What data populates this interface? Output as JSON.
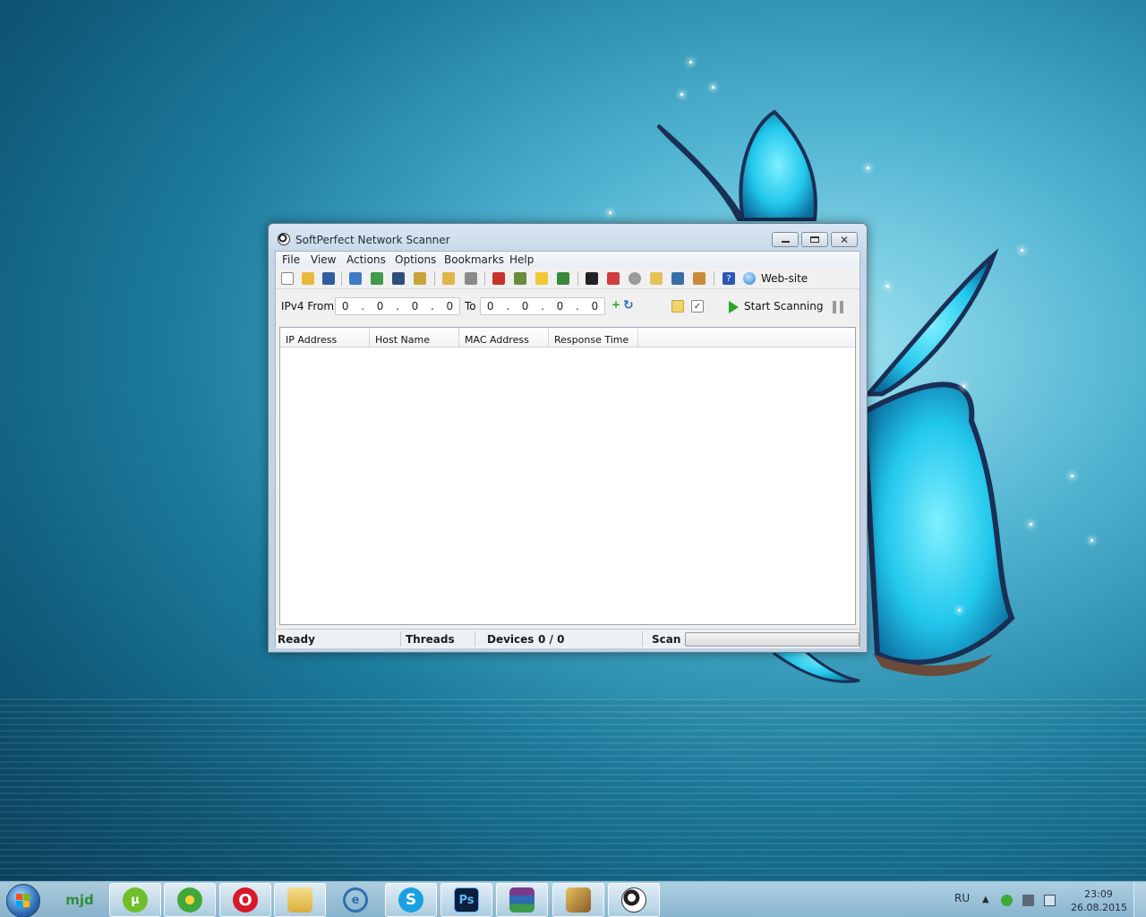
{
  "window": {
    "title": "SoftPerfect Network Scanner",
    "menu": [
      "File",
      "View",
      "Actions",
      "Options",
      "Bookmarks",
      "Help"
    ],
    "toolbar": {
      "website_label": "Web-site"
    },
    "range": {
      "from_label": "IPv4 From",
      "from_value": [
        "0",
        ".",
        "0",
        ".",
        "0",
        ".",
        "0"
      ],
      "to_label": "To",
      "to_value": [
        "0",
        ".",
        "0",
        ".",
        "0",
        ".",
        "0"
      ],
      "start_label": "Start Scanning"
    },
    "columns": [
      "IP Address",
      "Host Name",
      "MAC Address",
      "Response Time"
    ],
    "status": {
      "state": "Ready",
      "threads_label": "Threads",
      "devices_label": "Devices",
      "devices_value": "0 / 0",
      "scan_label": "Scan",
      "scan_progress": 0
    }
  },
  "taskbar": {
    "apps": [
      {
        "name": "mjd",
        "icon": "mjd-icon",
        "active": false
      },
      {
        "name": "uTorrent",
        "icon": "utorrent-icon",
        "active": true
      },
      {
        "name": "ICQ",
        "icon": "icq-icon",
        "active": true
      },
      {
        "name": "Opera",
        "icon": "opera-icon",
        "active": true
      },
      {
        "name": "Explorer",
        "icon": "folder-icon",
        "active": true
      },
      {
        "name": "Browser",
        "icon": "browser-icon",
        "active": false
      },
      {
        "name": "Skype",
        "icon": "skype-icon",
        "active": true
      },
      {
        "name": "Photoshop",
        "icon": "photoshop-icon",
        "active": true
      },
      {
        "name": "WinRAR",
        "icon": "winrar-icon",
        "active": true
      },
      {
        "name": "Archiver",
        "icon": "archive-icon",
        "active": true
      },
      {
        "name": "SoftPerfect Network Scanner",
        "icon": "soccer-ball-icon",
        "active": true
      }
    ],
    "tray": {
      "language": "RU",
      "time": "23:09",
      "date": "26.08.2015"
    }
  },
  "colors": {
    "accent": "#1f6fb3",
    "play_green": "#2aa62a"
  }
}
